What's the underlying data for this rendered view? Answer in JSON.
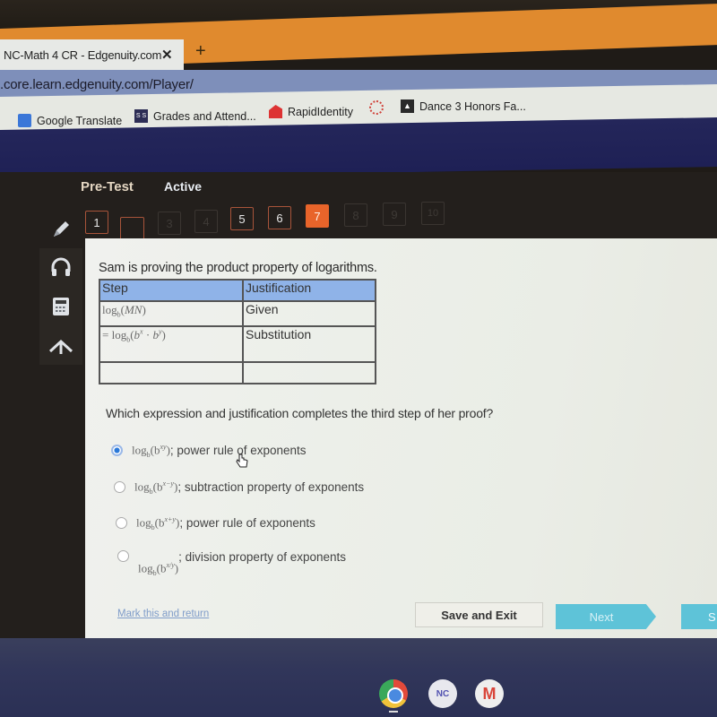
{
  "browser": {
    "tab_title": "NC-Math 4 CR - Edgenuity.com",
    "tab_close": "✕",
    "new_tab": "+",
    "url": ".core.learn.edgenuity.com/Player/",
    "bookmarks": [
      {
        "label": "Google Translate",
        "icon": "google-translate-icon"
      },
      {
        "label": "Grades and Attend...",
        "icon": "schoolsoft-icon",
        "icon_text": "S S"
      },
      {
        "label": "RapidIdentity",
        "icon": "rapididentity-icon"
      },
      {
        "label": "",
        "icon": "canvas-icon"
      },
      {
        "label": "Dance 3 Honors Fa...",
        "icon": "classroom-icon",
        "icon_text": "▲"
      }
    ]
  },
  "app": {
    "assessment_type": "Pre-Test",
    "status": "Active",
    "questions": [
      {
        "label": "1",
        "state": "answered"
      },
      {
        "label": "",
        "state": "answered"
      },
      {
        "label": "3",
        "state": "unvisited"
      },
      {
        "label": "4",
        "state": "unvisited"
      },
      {
        "label": "5",
        "state": "answered"
      },
      {
        "label": "6",
        "state": "answered"
      },
      {
        "label": "7",
        "state": "current"
      },
      {
        "label": "8",
        "state": "unvisited"
      },
      {
        "label": "9",
        "state": "unvisited"
      },
      {
        "label": "10",
        "state": "unvisited"
      }
    ],
    "tools": [
      "pencil-icon",
      "headphones-icon",
      "calculator-icon",
      "collapse-arrow-icon"
    ]
  },
  "question": {
    "prompt": "Sam is proving the product property of logarithms.",
    "table": {
      "headers": [
        "Step",
        "Justification"
      ],
      "rows": [
        {
          "step": "log_b(MN)",
          "justification": "Given"
        },
        {
          "step": "= log_b(b^x · b^y)",
          "justification": "Substitution"
        },
        {
          "step": "",
          "justification": ""
        }
      ]
    },
    "text": "Which expression and justification completes the third step of her proof?",
    "choices": [
      {
        "expr_base": "log",
        "expr_sub": "b",
        "expr_arg": "(b",
        "expr_sup": "xy",
        "expr_close": ")",
        "justification": "; power rule of exponents",
        "selected": true
      },
      {
        "expr_base": "log",
        "expr_sub": "b",
        "expr_arg": "(b",
        "expr_sup": "x−y",
        "expr_close": ")",
        "justification": "; subtraction property of exponents",
        "selected": false
      },
      {
        "expr_base": "log",
        "expr_sub": "b",
        "expr_arg": "(b",
        "expr_sup": "x+y",
        "expr_close": ")",
        "justification": "; power rule of exponents",
        "selected": false
      },
      {
        "expr_base": "log",
        "expr_sub": "b",
        "expr_arg": "(b",
        "expr_sup": "x/y",
        "expr_close": ")",
        "justification": "; division property of exponents",
        "selected": false
      }
    ]
  },
  "footer": {
    "mark_link": "Mark this and return",
    "save_exit": "Save and Exit",
    "next": "Next",
    "submit": "S"
  },
  "shelf": {
    "apps": [
      "chrome-icon",
      "nc-app-icon",
      "gmail-icon"
    ],
    "nc_label": "NC",
    "gmail_label": "M"
  },
  "colors": {
    "accent_orange": "#e8642a",
    "next_button": "#5ec3d8",
    "table_header": "#8fb3e8"
  }
}
